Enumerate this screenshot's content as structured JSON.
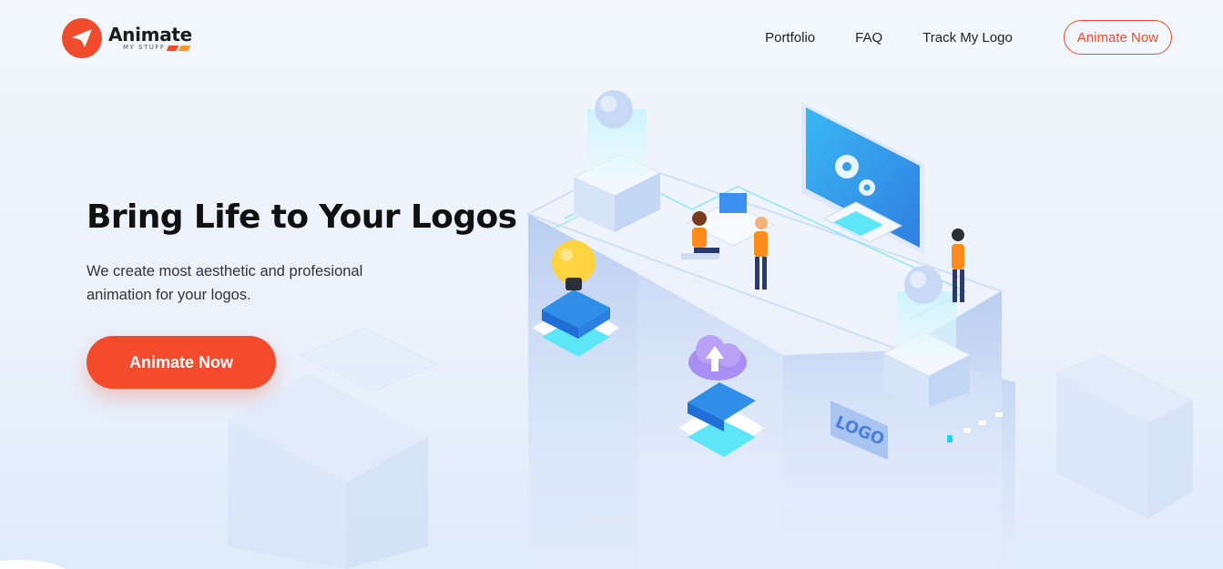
{
  "brand": {
    "name": "Animate",
    "subname": "MY STUFF",
    "colors": {
      "accent": "#f04b2c",
      "accent_secondary": "#f39a2c",
      "text_dark": "#111111",
      "background": "#eef3fb"
    }
  },
  "nav": {
    "links": [
      {
        "label": "Portfolio"
      },
      {
        "label": "FAQ"
      },
      {
        "label": "Track My Logo"
      }
    ],
    "cta_label": "Animate Now"
  },
  "hero": {
    "title": "Bring Life to Your Logos",
    "subtitle_lines": [
      "We create most aesthetic and profesional",
      "animation for your logos."
    ],
    "cta_label": "Animate Now"
  },
  "illustration": {
    "sign_text": "LOGO",
    "icons": [
      "lightbulb-icon",
      "cloud-upload-icon",
      "gear-icon",
      "monitor-icon",
      "paper-plane-icon"
    ]
  }
}
